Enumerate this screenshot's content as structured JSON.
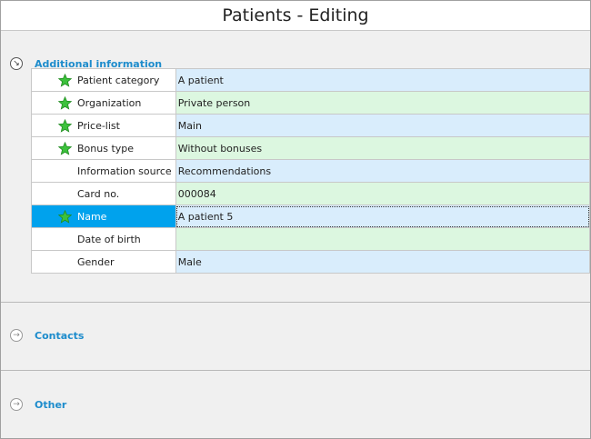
{
  "window": {
    "title": "Patients - Editing"
  },
  "sections": {
    "additional": {
      "label": "Additional information"
    },
    "contacts": {
      "label": "Contacts"
    },
    "other": {
      "label": "Other"
    }
  },
  "fields": [
    {
      "label": "Patient category",
      "value": "A patient",
      "required": true,
      "icon": "star-icon"
    },
    {
      "label": "Organization",
      "value": "Private person",
      "required": true,
      "icon": "star-icon"
    },
    {
      "label": "Price-list",
      "value": "Main",
      "required": true,
      "icon": "star-icon"
    },
    {
      "label": "Bonus type",
      "value": "Without bonuses",
      "required": true,
      "icon": "star-icon"
    },
    {
      "label": "Information source",
      "value": "Recommendations",
      "required": false
    },
    {
      "label": "Card no.",
      "value": "000084",
      "required": false
    },
    {
      "label": "Name",
      "value": "A patient 5",
      "required": true,
      "icon": "star-icon",
      "selected": true
    },
    {
      "label": "Date of birth",
      "value": "",
      "required": false
    },
    {
      "label": "Gender",
      "value": "Male",
      "required": false
    }
  ],
  "colors": {
    "accent": "#1d8ccc",
    "selection": "#00a2ed",
    "row_blue": "#d9edfc",
    "row_green": "#dcf7e0",
    "star": "#3cc13c"
  }
}
